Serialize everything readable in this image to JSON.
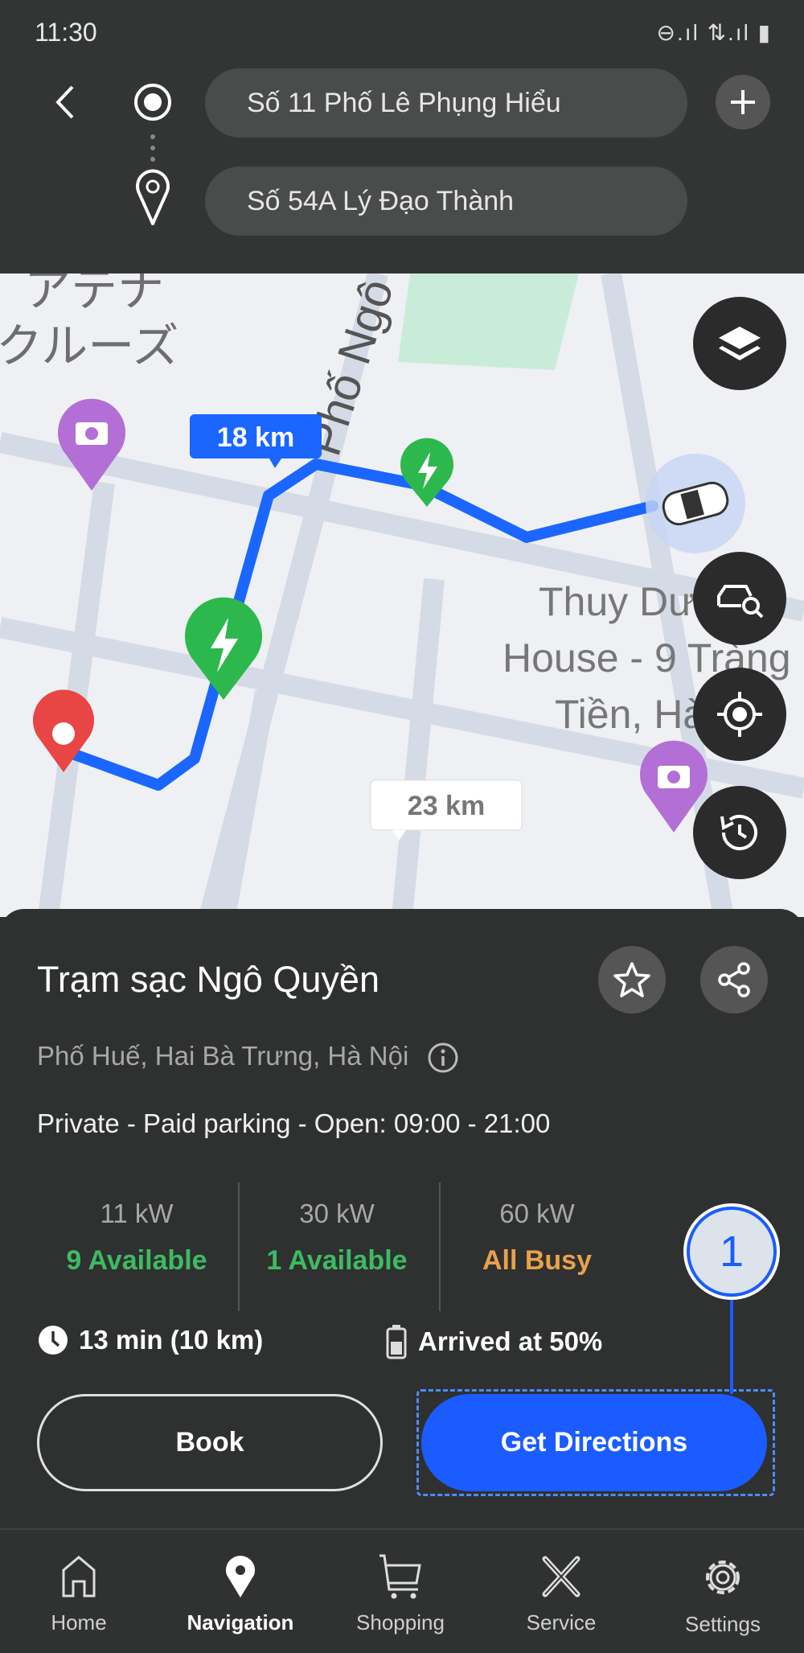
{
  "status_bar": {
    "time": "11:30",
    "icons": "⊖.ıl ⇅.ıl ▮"
  },
  "header": {
    "origin": "Số 11 Phố Lê Phụng Hiểu",
    "destination": "Số 54A Lý Đạo Thành"
  },
  "map": {
    "labels": {
      "poi_jp_1": "アテナ",
      "poi_jp_2": "クルーズ",
      "street": "Phố Ngô",
      "poi_1": "Thuy Dương",
      "poi_2": "House - 9 Tràng",
      "poi_3": "Tiền, Hà Nội"
    },
    "route_label_primary": "18 km",
    "route_label_alt": "23 km",
    "colors": {
      "route": "#1a66ff",
      "charger": "#2db84d",
      "destination": "#e84545",
      "camera_poi": "#b36fd6"
    }
  },
  "station": {
    "name": "Trạm sạc Ngô Quyền",
    "address": "Phố Huế, Hai Bà Trưng, Hà Nội",
    "info": "Private - Paid parking - Open: 09:00 - 21:00",
    "chargers": [
      {
        "power": "11 kW",
        "status": "9 Available",
        "color": "#3dbb63"
      },
      {
        "power": "30 kW",
        "status": "1 Available",
        "color": "#3dbb63"
      },
      {
        "power": "60 kW",
        "status": "All Busy",
        "color": "#e8a24a"
      }
    ],
    "eta": "13 min (10 km)",
    "arrival": "Arrived at 50%",
    "book_label": "Book",
    "directions_label": "Get Directions"
  },
  "annotation": {
    "number": "1"
  },
  "nav": [
    {
      "label": "Home",
      "icon": "home-icon"
    },
    {
      "label": "Navigation",
      "icon": "pin-icon",
      "active": true
    },
    {
      "label": "Shopping",
      "icon": "cart-icon"
    },
    {
      "label": "Service",
      "icon": "tools-icon"
    },
    {
      "label": "Settings",
      "icon": "gear-icon"
    }
  ]
}
